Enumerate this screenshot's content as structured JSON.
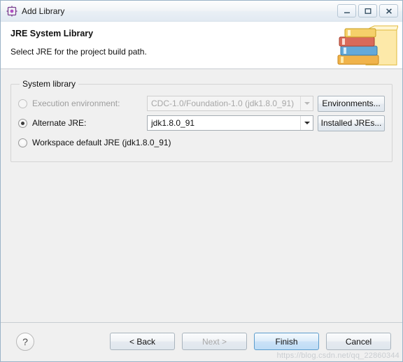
{
  "window": {
    "title": "Add Library",
    "icon": "app-icon",
    "buttons": {
      "minimize": "minimize-icon",
      "maximize": "maximize-icon",
      "close": "close-icon"
    }
  },
  "header": {
    "title": "JRE System Library",
    "subtitle": "Select JRE for the project build path.",
    "banner_icon": "books-icon"
  },
  "group": {
    "legend": "System library",
    "options": [
      {
        "id": "execution-environment",
        "label": "Execution environment:",
        "selected": false,
        "enabled": false,
        "combo_value": "CDC-1.0/Foundation-1.0 (jdk1.8.0_91)",
        "button_label": "Environments..."
      },
      {
        "id": "alternate-jre",
        "label": "Alternate JRE:",
        "selected": true,
        "enabled": true,
        "combo_value": "jdk1.8.0_91",
        "button_label": "Installed JREs..."
      },
      {
        "id": "workspace-default-jre",
        "label": "Workspace default JRE (jdk1.8.0_91)",
        "selected": false,
        "enabled": true
      }
    ]
  },
  "footer": {
    "help_label": "?",
    "buttons": [
      {
        "id": "back",
        "label": "< Back",
        "enabled": true,
        "default": false
      },
      {
        "id": "next",
        "label": "Next >",
        "enabled": false,
        "default": false
      },
      {
        "id": "finish",
        "label": "Finish",
        "enabled": true,
        "default": true
      },
      {
        "id": "cancel",
        "label": "Cancel",
        "enabled": true,
        "default": false
      }
    ]
  },
  "watermark": "https://blog.csdn.net/qq_22860344"
}
